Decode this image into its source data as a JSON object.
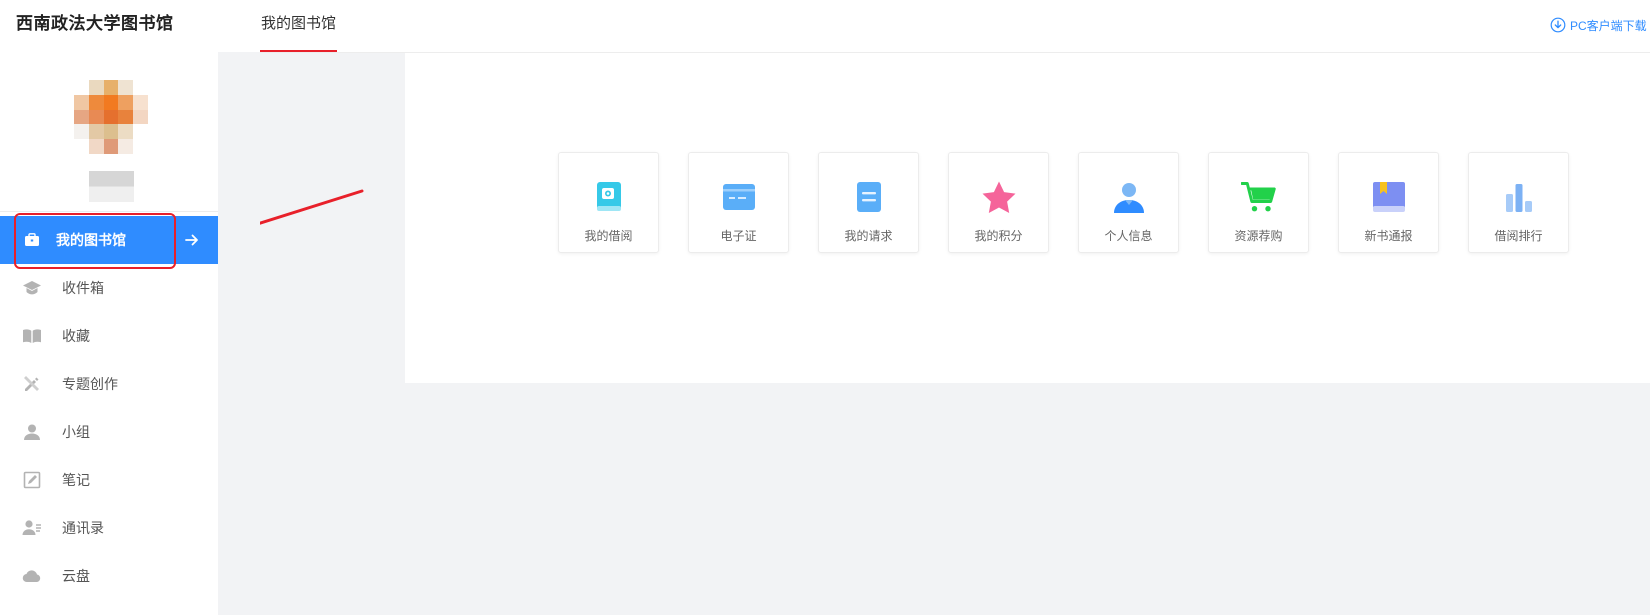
{
  "app": {
    "title": "西南政法大学图书馆"
  },
  "header": {
    "tab_label": "我的图书馆",
    "download_label": "PC客户端下载"
  },
  "sidebar": {
    "items": [
      {
        "label": "我的图书馆",
        "icon": "briefcase-icon",
        "active": true
      },
      {
        "label": "收件箱",
        "icon": "graduation-cap-icon"
      },
      {
        "label": "收藏",
        "icon": "open-book-icon"
      },
      {
        "label": "专题创作",
        "icon": "pencil-ruler-icon"
      },
      {
        "label": "小组",
        "icon": "user-icon"
      },
      {
        "label": "笔记",
        "icon": "note-icon"
      },
      {
        "label": "通讯录",
        "icon": "contacts-icon"
      },
      {
        "label": "云盘",
        "icon": "cloud-icon"
      }
    ]
  },
  "tiles": [
    {
      "label": "我的借阅",
      "icon": "borrow-book-icon"
    },
    {
      "label": "电子证",
      "icon": "e-card-icon"
    },
    {
      "label": "我的请求",
      "icon": "request-doc-icon"
    },
    {
      "label": "我的积分",
      "icon": "star-icon"
    },
    {
      "label": "个人信息",
      "icon": "person-icon"
    },
    {
      "label": "资源荐购",
      "icon": "shopping-cart-icon"
    },
    {
      "label": "新书通报",
      "icon": "new-book-icon"
    },
    {
      "label": "借阅排行",
      "icon": "bar-chart-icon"
    }
  ],
  "colors": {
    "accent": "#2f8cff",
    "highlight": "#e8202a",
    "background": "#f2f3f5"
  }
}
